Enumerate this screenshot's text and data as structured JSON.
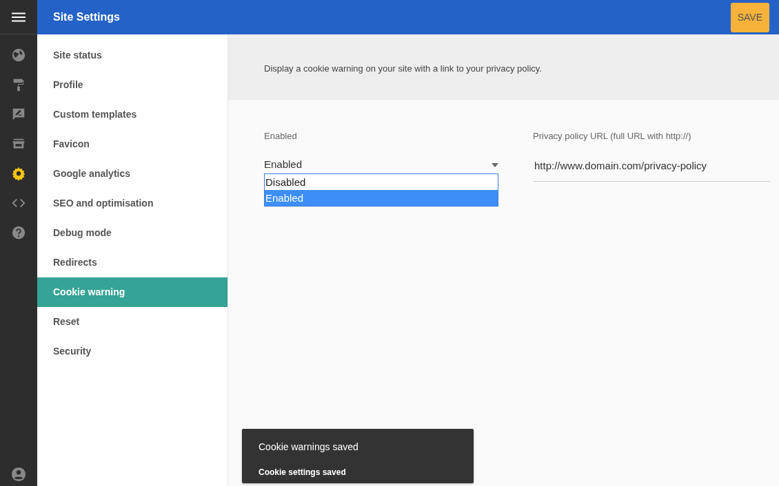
{
  "header": {
    "title": "Site Settings",
    "save_button": "SAVE"
  },
  "rail": [
    {
      "kind": "globe",
      "selected": false
    },
    {
      "kind": "roller",
      "selected": false
    },
    {
      "kind": "comment",
      "selected": false
    },
    {
      "kind": "store",
      "selected": false
    },
    {
      "kind": "gear",
      "selected": true
    },
    {
      "kind": "code",
      "selected": false
    },
    {
      "kind": "help",
      "selected": false
    }
  ],
  "menu": [
    {
      "label": "Site status",
      "selected": false
    },
    {
      "label": "Profile",
      "selected": false
    },
    {
      "label": "Custom templates",
      "selected": false
    },
    {
      "label": "Favicon",
      "selected": false
    },
    {
      "label": "Google analytics",
      "selected": false
    },
    {
      "label": "SEO and optimisation",
      "selected": false
    },
    {
      "label": "Debug mode",
      "selected": false
    },
    {
      "label": "Redirects",
      "selected": false
    },
    {
      "label": "Cookie warning",
      "selected": true
    },
    {
      "label": "Reset",
      "selected": false
    },
    {
      "label": "Security",
      "selected": false
    }
  ],
  "intro": "Display a cookie warning on your site with a link to your privacy policy.",
  "enabled_field": {
    "label": "Enabled",
    "value": "Enabled",
    "options": [
      {
        "label": "Disabled",
        "selected": false
      },
      {
        "label": "Enabled",
        "selected": true
      }
    ]
  },
  "url_field": {
    "label": "Privacy policy URL (full URL with http://)",
    "value": "http://www.domain.com/privacy-policy"
  },
  "toast": {
    "title": "Cookie warnings saved",
    "message": "Cookie settings saved"
  }
}
